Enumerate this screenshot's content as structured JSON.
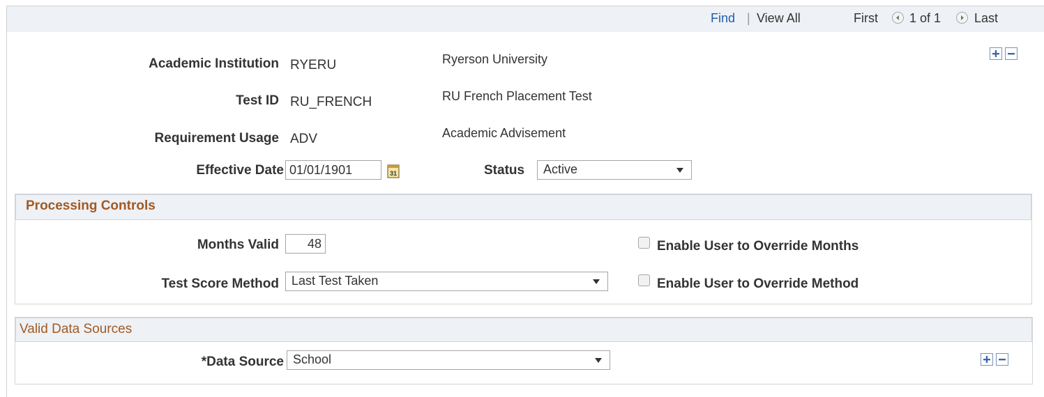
{
  "nav": {
    "find": "Find",
    "separator": "|",
    "view_all": "View All",
    "first": "First",
    "counter": "1 of 1",
    "last": "Last"
  },
  "header": {
    "academic_institution": {
      "label": "Academic Institution",
      "value": "RYERU",
      "description": "Ryerson University"
    },
    "test_id": {
      "label": "Test ID",
      "value": "RU_FRENCH",
      "description": "RU French Placement Test"
    },
    "requirement_usage": {
      "label": "Requirement Usage",
      "value": "ADV",
      "description": "Academic Advisement"
    },
    "effective_date": {
      "label": "Effective Date",
      "value": "01/01/1901",
      "calendar_icon": "calendar-icon"
    },
    "status": {
      "label": "Status",
      "selected": "Active"
    }
  },
  "processing_controls": {
    "title": "Processing Controls",
    "months_valid": {
      "label": "Months Valid",
      "value": "48"
    },
    "test_score_method": {
      "label": "Test Score Method",
      "selected": "Last Test Taken"
    },
    "override_months": {
      "label": "Enable User to Override Months",
      "checked": false
    },
    "override_method": {
      "label": "Enable User to Override Method",
      "checked": false
    }
  },
  "valid_data_sources": {
    "title": "Valid Data Sources",
    "data_source": {
      "label": "*Data Source",
      "selected": "School"
    }
  },
  "colors": {
    "link": "#1f5fa8",
    "group_title": "#a15a23",
    "header_bg": "#eef1f5"
  }
}
